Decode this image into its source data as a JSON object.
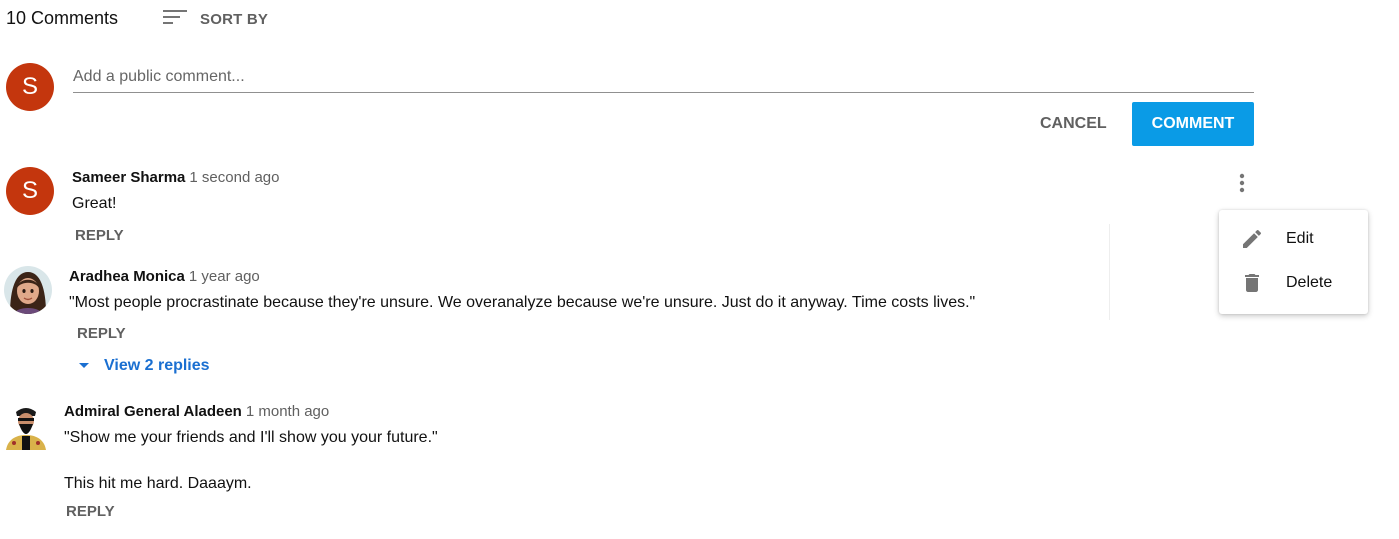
{
  "header": {
    "comment_count": "10 Comments",
    "sort_label": "SORT BY"
  },
  "composer": {
    "avatar_letter": "S",
    "placeholder": "Add a public comment...",
    "cancel_label": "CANCEL",
    "submit_label": "COMMENT"
  },
  "comments": [
    {
      "avatar_letter": "S",
      "author": "Sameer Sharma",
      "time": "1 second ago",
      "text": "Great!",
      "reply_label": "REPLY"
    },
    {
      "author": "Aradhea Monica",
      "time": "1 year ago",
      "text": "\"Most people procrastinate because they're unsure. We overanalyze because we're unsure. Just do it anyway. Time costs lives.\"",
      "reply_label": "REPLY",
      "view_replies_label": "View 2 replies"
    },
    {
      "author": "Admiral General Aladeen",
      "time": "1 month ago",
      "text_line1": "\"Show me your friends and I'll show you your future.\"",
      "text_line2": "This hit me hard. Daaaym.",
      "reply_label": "REPLY"
    }
  ],
  "context_menu": {
    "items": [
      {
        "label": "Edit",
        "icon": "pencil-icon"
      },
      {
        "label": "Delete",
        "icon": "trash-icon"
      }
    ]
  },
  "colors": {
    "avatar_bg": "#c4360d",
    "primary_button": "#0a9be6",
    "link_blue": "#1a6fd1",
    "icon_gray": "#757575"
  }
}
